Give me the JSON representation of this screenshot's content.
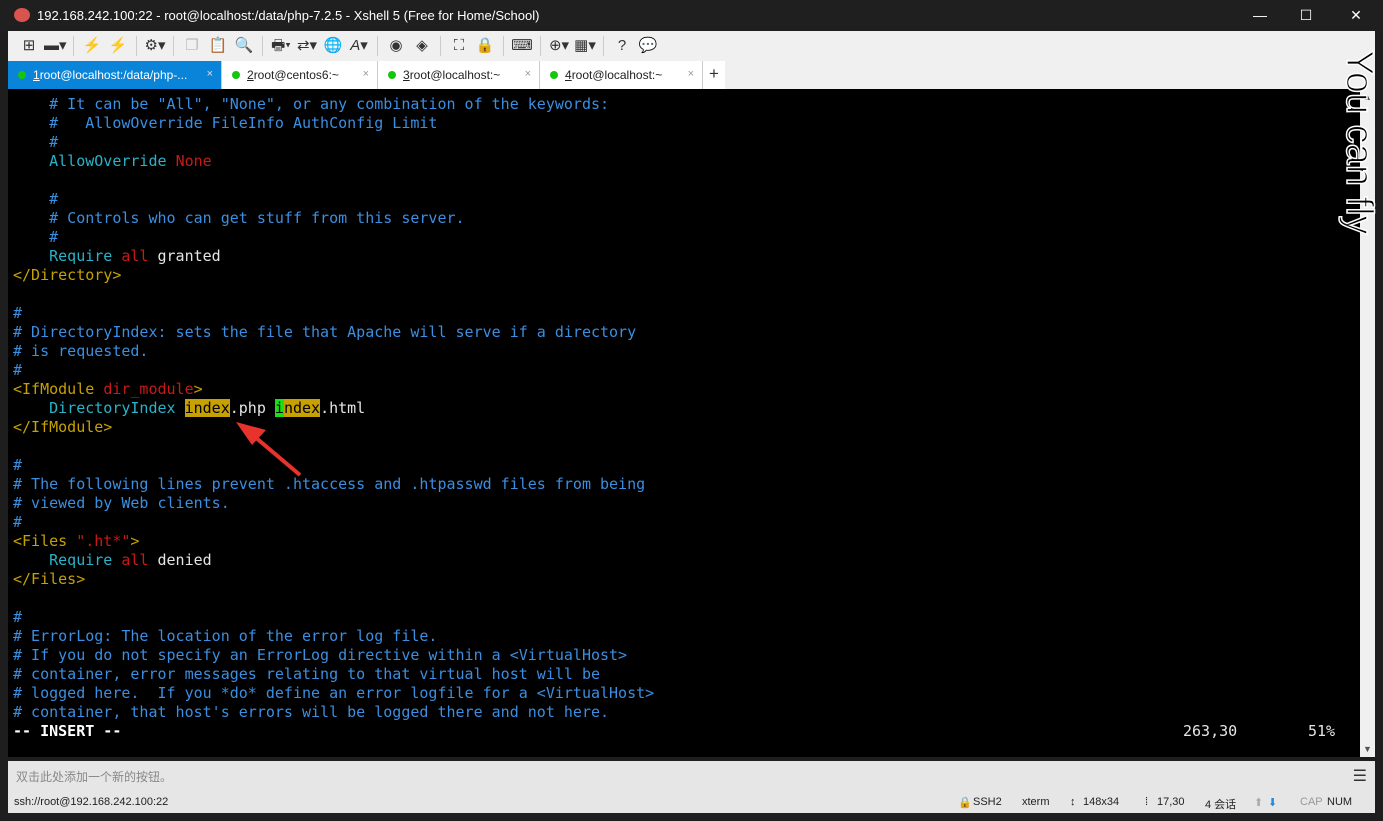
{
  "window": {
    "title": "192.168.242.100:22 - root@localhost:/data/php-7.2.5 - Xshell 5 (Free for Home/School)",
    "minimize": "—",
    "maximize": "☐",
    "close": "✕"
  },
  "toolbar": {
    "icons": [
      "new-session",
      "open-folder",
      "connect",
      "disconnect",
      "properties",
      "copy",
      "paste",
      "find",
      "print",
      "transfer",
      "globe",
      "font",
      "xftp",
      "xshell-logo",
      "fullscreen",
      "lock",
      "keyboard",
      "add-tab",
      "layout",
      "help",
      "chat"
    ]
  },
  "tabs": [
    {
      "num": "1",
      "label": " root@localhost:/data/php-...",
      "close": "×",
      "status_color": "#16c60c"
    },
    {
      "num": "2",
      "label": " root@centos6:~",
      "close": "×",
      "status_color": "#16c60c"
    },
    {
      "num": "3",
      "label": " root@localhost:~",
      "close": "×",
      "status_color": "#16c60c"
    },
    {
      "num": "4",
      "label": " root@localhost:~",
      "close": "×",
      "status_color": "#16c60c"
    }
  ],
  "add_tab": "+",
  "terminal": {
    "lines": [
      [
        [
          "    # It can be \"All\", \"None\", or any combination of the keywords:",
          "c"
        ]
      ],
      [
        [
          "    #   AllowOverride FileInfo AuthConfig Limit",
          "c"
        ]
      ],
      [
        [
          "    #",
          "c"
        ]
      ],
      [
        [
          "    AllowOverride ",
          "cy"
        ],
        [
          "None",
          "r"
        ]
      ],
      [],
      [
        [
          "    #",
          "c"
        ]
      ],
      [
        [
          "    # Controls who can get stuff from this server.",
          "c"
        ]
      ],
      [
        [
          "    #",
          "c"
        ]
      ],
      [
        [
          "    Require ",
          "cy"
        ],
        [
          "all ",
          "r"
        ],
        [
          "granted",
          "w"
        ]
      ],
      [
        [
          "</Directory>",
          "y"
        ]
      ],
      [],
      [
        [
          "#",
          "c"
        ]
      ],
      [
        [
          "# DirectoryIndex: sets the file that Apache will serve if a directory",
          "c"
        ]
      ],
      [
        [
          "# is requested.",
          "c"
        ]
      ],
      [
        [
          "#",
          "c"
        ]
      ],
      [
        [
          "<IfModule ",
          "y"
        ],
        [
          "dir_module",
          "r"
        ],
        [
          ">",
          "y"
        ]
      ],
      [
        [
          "    DirectoryIndex ",
          "cy"
        ],
        [
          "index",
          "hy"
        ],
        [
          ".php ",
          "w"
        ],
        [
          "i",
          "hg"
        ],
        [
          "ndex",
          "hy"
        ],
        [
          ".html",
          "w"
        ]
      ],
      [
        [
          "</IfModule>",
          "y"
        ]
      ],
      [],
      [
        [
          "#",
          "c"
        ]
      ],
      [
        [
          "# The following lines prevent .htaccess and .htpasswd files from being",
          "c"
        ]
      ],
      [
        [
          "# viewed by Web clients.",
          "c"
        ]
      ],
      [
        [
          "#",
          "c"
        ]
      ],
      [
        [
          "<Files ",
          "y"
        ],
        [
          "\".ht*\"",
          "r"
        ],
        [
          ">",
          "y"
        ]
      ],
      [
        [
          "    Require ",
          "cy"
        ],
        [
          "all ",
          "r"
        ],
        [
          "denied",
          "w"
        ]
      ],
      [
        [
          "</Files>",
          "y"
        ]
      ],
      [],
      [
        [
          "#",
          "c"
        ]
      ],
      [
        [
          "# ErrorLog: The location of the error log file.",
          "c"
        ]
      ],
      [
        [
          "# If you do not specify an ErrorLog directive within a <VirtualHost>",
          "c"
        ]
      ],
      [
        [
          "# container, error messages relating to that virtual host will be",
          "c"
        ]
      ],
      [
        [
          "# logged here.  If you *do* define an error logfile for a <VirtualHost>",
          "c"
        ]
      ],
      [
        [
          "# container, that host's errors will be logged there and not here.",
          "c"
        ]
      ],
      [
        [
          "-- INSERT --",
          "b"
        ]
      ]
    ],
    "cursor_pos": "263,30",
    "percent": "51%",
    "watermark": "You can fly",
    "annotation_color": "#e8322c"
  },
  "quickbar": {
    "hint": "双击此处添加一个新的按钮。",
    "menu": "☰"
  },
  "statusbar": {
    "address": "ssh://root@192.168.242.100:22",
    "protocol": "SSH2",
    "term": "xterm",
    "size": "148x34",
    "cursor": "17,30",
    "sessions": "4 会话",
    "cap": "CAP",
    "num": "NUM"
  }
}
